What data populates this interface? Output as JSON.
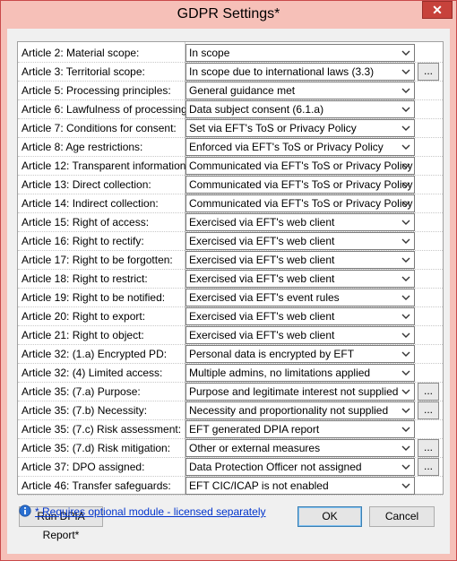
{
  "window": {
    "title": "GDPR Settings*",
    "close_label": "✕"
  },
  "rows": [
    {
      "label": "Article 2: Material scope:",
      "value": "In scope",
      "has_more": false
    },
    {
      "label": "Article 3: Territorial scope:",
      "value": "In scope due to international laws (3.3)",
      "has_more": true
    },
    {
      "label": "Article 5: Processing principles:",
      "value": "General guidance met",
      "has_more": false
    },
    {
      "label": "Article 6: Lawfulness of processing:",
      "value": "Data subject consent (6.1.a)",
      "has_more": false
    },
    {
      "label": "Article 7: Conditions for consent:",
      "value": "Set via EFT's ToS or Privacy Policy",
      "has_more": false
    },
    {
      "label": "Article 8: Age restrictions:",
      "value": "Enforced via EFT's ToS or Privacy Policy",
      "has_more": false
    },
    {
      "label": "Article 12: Transparent information:",
      "value": "Communicated via EFT's ToS or Privacy Policy",
      "has_more": false
    },
    {
      "label": "Article 13: Direct collection:",
      "value": "Communicated via EFT's ToS or Privacy Policy",
      "has_more": false
    },
    {
      "label": "Article 14: Indirect collection:",
      "value": "Communicated via EFT's ToS or Privacy Policy",
      "has_more": false
    },
    {
      "label": "Article 15: Right of access:",
      "value": "Exercised via EFT's web client",
      "has_more": false
    },
    {
      "label": "Article 16: Right to rectify:",
      "value": "Exercised via EFT's web client",
      "has_more": false
    },
    {
      "label": "Article 17: Right to be forgotten:",
      "value": "Exercised via EFT's web client",
      "has_more": false
    },
    {
      "label": "Article 18: Right to restrict:",
      "value": "Exercised via EFT's web client",
      "has_more": false
    },
    {
      "label": "Article 19: Right to be notified:",
      "value": "Exercised via EFT's event rules",
      "has_more": false
    },
    {
      "label": "Article 20: Right to export:",
      "value": "Exercised via EFT's web client",
      "has_more": false
    },
    {
      "label": "Article 21: Right to object:",
      "value": "Exercised via EFT's web client",
      "has_more": false
    },
    {
      "label": "Article 32: (1.a) Encrypted PD:",
      "value": "Personal data is encrypted by EFT",
      "has_more": false
    },
    {
      "label": "Article 32: (4) Limited access:",
      "value": "Multiple admins, no limitations applied",
      "has_more": false
    },
    {
      "label": "Article 35: (7.a) Purpose:",
      "value": "Purpose and legitimate interest not supplied",
      "has_more": true
    },
    {
      "label": "Article 35: (7.b) Necessity:",
      "value": "Necessity and proportionality not supplied",
      "has_more": true
    },
    {
      "label": "Article 35: (7.c) Risk assessment:",
      "value": "EFT generated DPIA report",
      "has_more": false
    },
    {
      "label": "Article 35: (7.d) Risk mitigation:",
      "value": "Other or external measures",
      "has_more": true
    },
    {
      "label": "Article 37: DPO assigned:",
      "value": "Data Protection Officer not assigned",
      "has_more": true
    },
    {
      "label": "Article 46: Transfer safeguards:",
      "value": "EFT CIC/ICAP is not enabled",
      "has_more": false
    }
  ],
  "more_button_label": "...",
  "buttons": {
    "run_dpia": "Run DPIA Report*",
    "ok": "OK",
    "cancel": "Cancel"
  },
  "footnote": "* Requires optional module - licensed separately",
  "icons": {
    "dropdown": "chevron-down-icon",
    "info": "info-icon",
    "close": "close-icon"
  },
  "colors": {
    "titlebar": "#f6c0b8",
    "close": "#c7423b",
    "link": "#0033cc"
  }
}
